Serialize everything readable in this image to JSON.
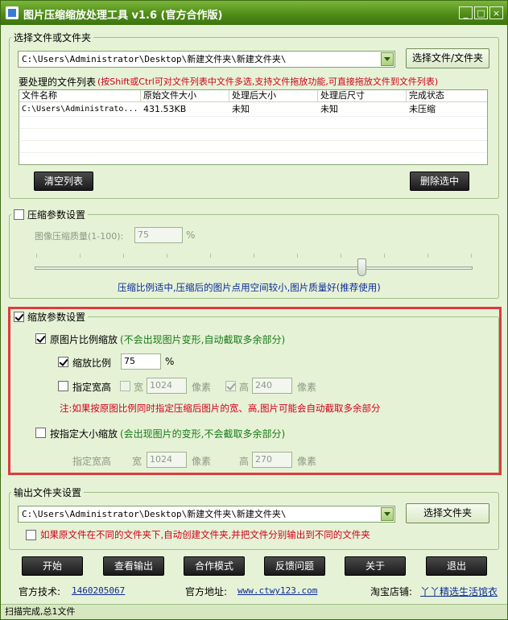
{
  "window": {
    "title": "图片压缩缩放处理工具 v1.6 (官方合作版)",
    "minimize": "_",
    "maximize": "□",
    "close": "×"
  },
  "select": {
    "legend": "选择文件或文件夹",
    "path": "C:\\Users\\Administrator\\Desktop\\新建文件夹\\新建文件夹\\",
    "button": "选择文件/文件夹",
    "list_label": "要处理的文件列表",
    "list_hint": "(按Shift或Ctrl可对文件列表中文件多选,支持文件拖放功能,可直接拖放文件到文件列表)",
    "columns": [
      "文件名称",
      "原始文件大小",
      "处理后大小",
      "处理后尺寸",
      "完成状态"
    ],
    "rows": [
      [
        "C:\\Users\\Administrato...",
        "431.53KB",
        "未知",
        "未知",
        "未压缩"
      ]
    ],
    "clear_button": "清空列表",
    "delete_button": "删除选中"
  },
  "compress": {
    "legend": "压缩参数设置",
    "quality_label": "图像压缩质量(1-100):",
    "quality_value": "75",
    "quality_unit": "%",
    "note": "压缩比例适中,压缩后的图片点用空间较小,图片质量好(推荐使用)",
    "slider_value": 75
  },
  "scale": {
    "legend": "缩放参数设置",
    "ratio_scale_label": "原图片比例缩放",
    "ratio_scale_hint": "(不会出现图片变形,自动截取多余部分)",
    "scale_ratio_label": "缩放比例",
    "scale_ratio_value": "75",
    "scale_ratio_unit": "%",
    "specify_label": "指定宽高",
    "width_label": "宽",
    "width_value": "1024",
    "width_unit": "像素",
    "height_label": "高",
    "height_value": "240",
    "height_unit": "像素",
    "note": "注:如果按原图比例同时指定压缩后图片的宽、高,图片可能会自动截取多余部分",
    "fixed_size_label": "按指定大小缩放",
    "fixed_size_hint": "(会出现图片的变形,不会截取多余部分)",
    "fixed_specify_label": "指定宽高",
    "fixed_width_label": "宽",
    "fixed_width_value": "1024",
    "fixed_width_unit": "像素",
    "fixed_height_label": "高",
    "fixed_height_value": "270",
    "fixed_height_unit": "像素"
  },
  "output": {
    "legend": "输出文件夹设置",
    "path": "C:\\Users\\Administrator\\Desktop\\新建文件夹\\新建文件夹\\",
    "button": "选择文件夹",
    "auto_folder_label": "如果原文件在不同的文件夹下,自动创建文件夹,并把文件分别输出到不同的文件夹"
  },
  "actions": [
    "开始",
    "查看输出",
    "合作模式",
    "反馈问题",
    "关于",
    "退出"
  ],
  "footer": {
    "support_label": "官方技术:",
    "support_value": "1460205067",
    "site_label": "官方地址:",
    "site_value": "www.ctwy123.com",
    "shop_label": "淘宝店铺:",
    "shop_value": "丫丫精选生活馆衣"
  },
  "status": "扫描完成,总1文件"
}
